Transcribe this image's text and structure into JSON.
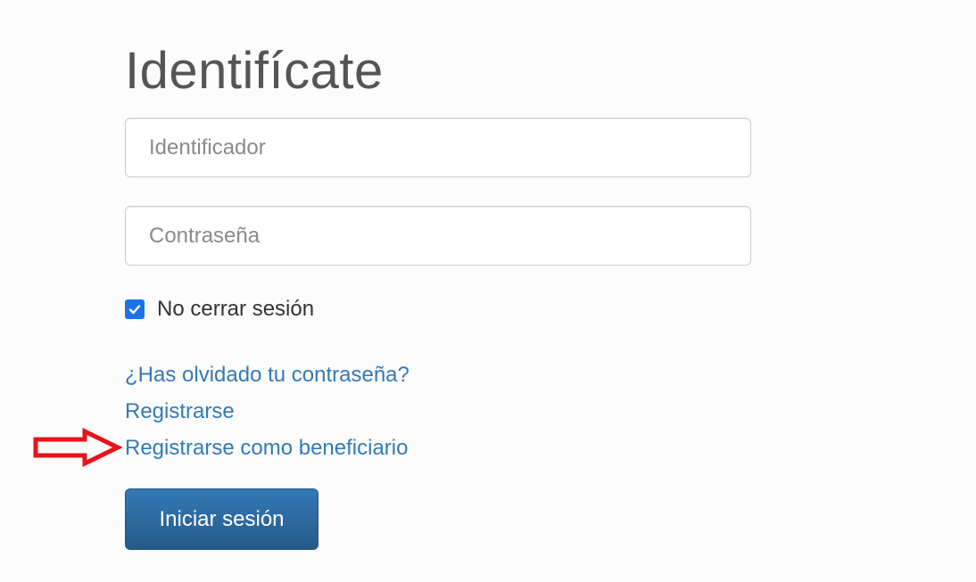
{
  "form": {
    "title": "Identifícate",
    "identifier_placeholder": "Identificador",
    "password_placeholder": "Contraseña",
    "remember_label": "No cerrar sesión",
    "remember_checked": true,
    "submit_label": "Iniciar sesión"
  },
  "links": {
    "forgot_password": "¿Has olvidado tu contraseña?",
    "register": "Registrarse",
    "register_beneficiary": "Registrarse como beneficiario"
  },
  "colors": {
    "link": "#337ab7",
    "button": "#2a6ea8",
    "checkbox": "#1a73e8",
    "annotation_arrow": "#e8131b"
  },
  "annotation": {
    "icon": "red-arrow-right-icon"
  }
}
